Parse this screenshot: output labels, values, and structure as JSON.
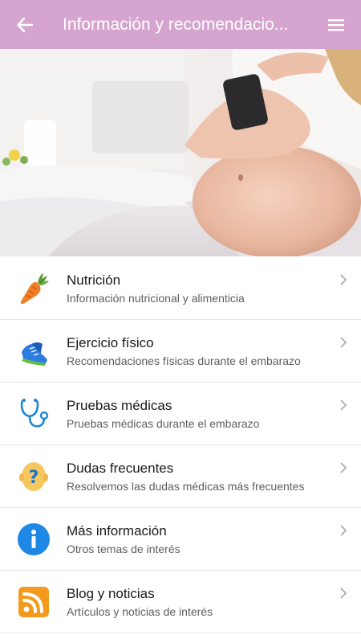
{
  "appbar": {
    "title": "Información y recomendacio...",
    "background": "#d5a5cf"
  },
  "hero": {
    "icon": "pregnant-woman-with-phone-photo"
  },
  "items": [
    {
      "icon": "carrot-icon",
      "title": "Nutrición",
      "subtitle": "Información nutricional y alimenticia"
    },
    {
      "icon": "sneaker-icon",
      "title": "Ejercicio físico",
      "subtitle": "Recomendaciones físicas durante el embarazo"
    },
    {
      "icon": "stethoscope-icon",
      "title": "Pruebas médicas",
      "subtitle": "Pruebas médicas durante el embarazo"
    },
    {
      "icon": "question-head-icon",
      "title": "Dudas frecuentes",
      "subtitle": "Resolvemos las dudas médicas más frecuentes"
    },
    {
      "icon": "info-icon",
      "title": "Más información",
      "subtitle": "Otros temas de interés"
    },
    {
      "icon": "rss-icon",
      "title": "Blog y noticias",
      "subtitle": "Artículos y noticias de interés"
    }
  ]
}
